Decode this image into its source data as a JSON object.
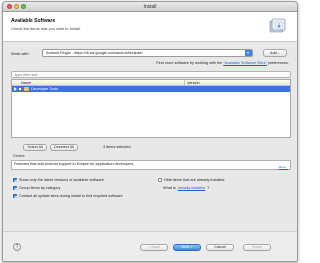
{
  "window": {
    "title": "Install"
  },
  "header": {
    "title": "Available Software",
    "subtitle": "Check the items that you wish to install.",
    "icon": "install-wizard-icon"
  },
  "work_with": {
    "label": "Work with:",
    "value": "Android Plugin - https://dl-ssl.google.com/android/eclipse/",
    "add_label": "Add..."
  },
  "more_software": {
    "prefix": "Find more software by working with the ",
    "link": "\"Available Software Sites\"",
    "suffix": " preferences."
  },
  "filter": {
    "placeholder": "type filter text"
  },
  "table": {
    "columns": [
      "Name",
      "Version"
    ],
    "rows": [
      {
        "name": "Developer Tools",
        "version": ""
      }
    ]
  },
  "selection": {
    "select_all": "Select All",
    "deselect_all": "Deselect All",
    "status": "3 items selected"
  },
  "details": {
    "label": "Details",
    "text": "Features that add Android support to Eclipse for application developers.",
    "more": "More..."
  },
  "options": {
    "latest_versions": "Show only the latest versions of available software",
    "group_by_category": "Group items by category",
    "contact_sites": "Contact all update sites during install to find required software",
    "hide_installed": "Hide items that are already installed",
    "already_installed_prefix": "What is ",
    "already_installed_link": "already installed",
    "already_installed_suffix": "?"
  },
  "footer": {
    "help": "?",
    "back": "< Back",
    "next": "Next >",
    "cancel": "Cancel",
    "finish": "Finish"
  }
}
